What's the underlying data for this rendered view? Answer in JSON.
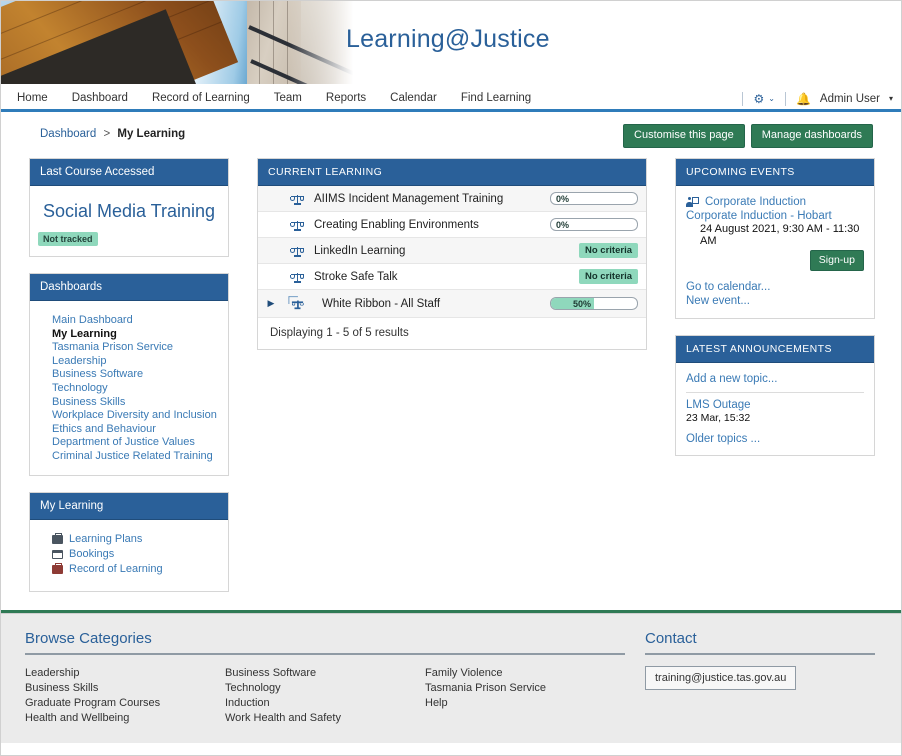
{
  "site": {
    "title": "Learning@Justice"
  },
  "nav": {
    "items": [
      {
        "label": "Home"
      },
      {
        "label": "Dashboard"
      },
      {
        "label": "Record of Learning"
      },
      {
        "label": "Team"
      },
      {
        "label": "Reports"
      },
      {
        "label": "Calendar"
      },
      {
        "label": "Find Learning"
      }
    ],
    "gear_icon": "gear-icon",
    "gear_caret": "⌄",
    "bell_icon": "bell-icon",
    "user_label": "Admin User",
    "user_caret": "▾"
  },
  "breadcrumb": {
    "parent": "Dashboard",
    "separator": ">",
    "current": "My Learning"
  },
  "page_actions": {
    "customise_label": "Customise this page",
    "manage_label": "Manage dashboards"
  },
  "blocks": {
    "last_course": {
      "title": "Last Course Accessed",
      "course_name": "Social Media Training",
      "status_badge": "Not tracked"
    },
    "dashboards": {
      "title": "Dashboards",
      "items": [
        {
          "label": "Main Dashboard",
          "active": false
        },
        {
          "label": "My Learning",
          "active": true
        },
        {
          "label": "Tasmania Prison Service",
          "active": false
        },
        {
          "label": "Leadership",
          "active": false
        },
        {
          "label": "Business Software",
          "active": false
        },
        {
          "label": "Technology",
          "active": false
        },
        {
          "label": "Business Skills",
          "active": false
        },
        {
          "label": "Workplace Diversity and Inclusion",
          "active": false
        },
        {
          "label": "Ethics and Behaviour",
          "active": false
        },
        {
          "label": "Department of Justice Values",
          "active": false
        },
        {
          "label": "Criminal Justice Related Training",
          "active": false
        }
      ]
    },
    "my_learning": {
      "title": "My Learning",
      "items": [
        {
          "label": "Learning Plans",
          "icon": "briefcase-icon"
        },
        {
          "label": "Bookings",
          "icon": "calendar-icon"
        },
        {
          "label": "Record of Learning",
          "icon": "briefcase-red-icon"
        }
      ]
    },
    "current_learning": {
      "title": "CURRENT LEARNING",
      "rows": [
        {
          "name": "AIIMS Incident Management Training",
          "icon": "course-scales-icon",
          "expandable": false,
          "progress": "0%",
          "percent": 0,
          "badge": null
        },
        {
          "name": "Creating Enabling Environments",
          "icon": "course-scales-icon",
          "expandable": false,
          "progress": "0%",
          "percent": 0,
          "badge": null
        },
        {
          "name": "LinkedIn Learning",
          "icon": "course-scales-icon",
          "expandable": false,
          "progress": null,
          "percent": null,
          "badge": "No criteria"
        },
        {
          "name": "Stroke Safe Talk",
          "icon": "course-scales-icon",
          "expandable": false,
          "progress": null,
          "percent": null,
          "badge": "No criteria"
        },
        {
          "name": "White Ribbon - All Staff",
          "icon": "program-scales-icon",
          "expandable": true,
          "expander": "▶",
          "progress": "50%",
          "percent": 50,
          "badge": null
        }
      ],
      "footer": "Displaying 1 - 5 of 5 results"
    },
    "upcoming_events": {
      "title": "UPCOMING EVENTS",
      "event_name": "Corporate Induction",
      "session_name": "Corporate Induction - Hobart",
      "session_time": "24 August 2021, 9:30 AM - 11:30 AM",
      "signup_label": "Sign-up",
      "links": [
        {
          "label": "Go to calendar..."
        },
        {
          "label": "New event..."
        }
      ]
    },
    "latest_announcements": {
      "title": "LATEST ANNOUNCEMENTS",
      "add_topic_label": "Add a new topic...",
      "topic_title": "LMS Outage",
      "topic_time": "23 Mar, 15:32",
      "older_label": "Older topics ..."
    }
  },
  "footer": {
    "browse_heading": "Browse Categories",
    "columns": [
      [
        {
          "label": "Leadership"
        },
        {
          "label": "Business Skills"
        },
        {
          "label": "Graduate Program Courses"
        },
        {
          "label": "Health and Wellbeing"
        }
      ],
      [
        {
          "label": "Business Software"
        },
        {
          "label": "Technology"
        },
        {
          "label": "Induction"
        },
        {
          "label": "Work Health and Safety"
        }
      ],
      [
        {
          "label": "Family Violence"
        },
        {
          "label": "Tasmania Prison Service"
        },
        {
          "label": "Help"
        }
      ]
    ],
    "contact_heading": "Contact",
    "contact_email": "training@justice.tas.gov.au"
  },
  "colors": {
    "block_header_blue": "#2a6099",
    "nav_rule_blue": "#2f7cba",
    "button_green": "#2f7a55",
    "badge_green": "#8fd8bc",
    "link_blue": "#3a7ab5",
    "footer_bg": "#ebebeb"
  }
}
